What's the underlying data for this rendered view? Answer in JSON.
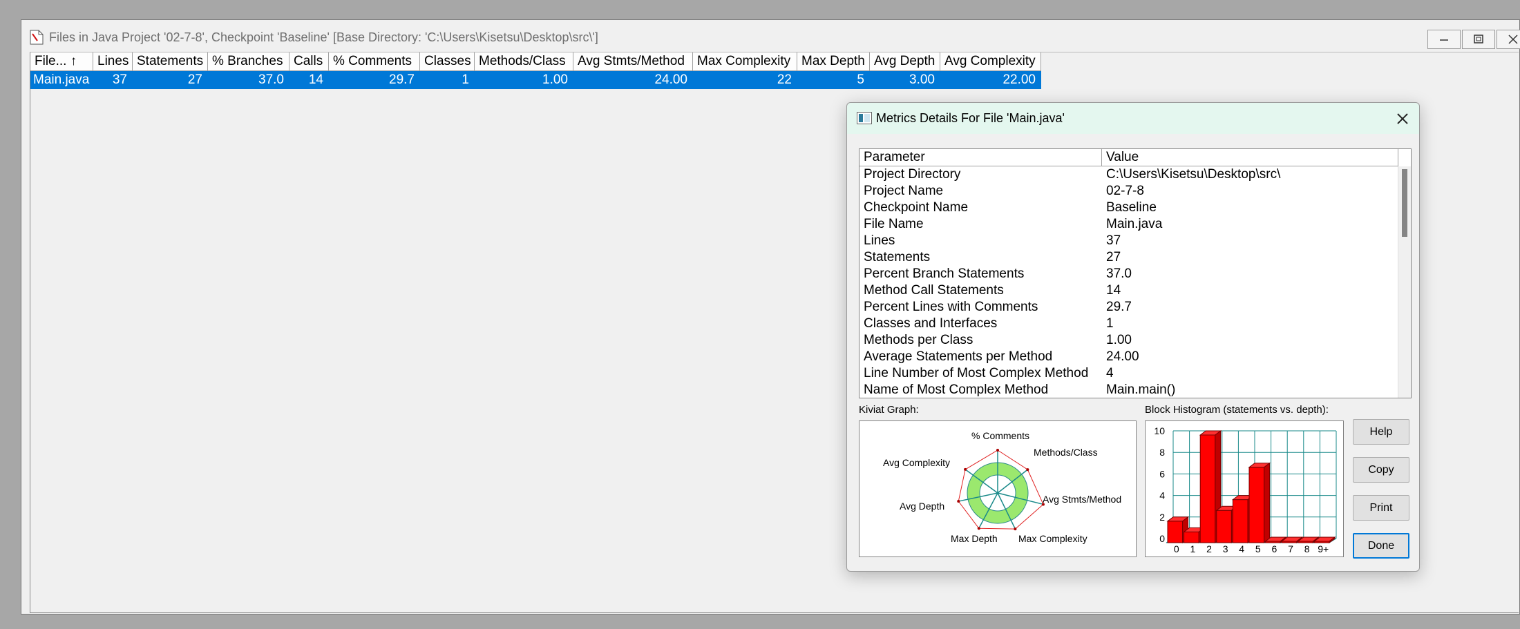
{
  "window": {
    "title": "Files in Java Project '02-7-8', Checkpoint 'Baseline'  [Base Directory: 'C:\\Users\\Kisetsu\\Desktop\\src\\']"
  },
  "grid": {
    "columns": [
      "File... ↑",
      "Lines",
      "Statements",
      "% Branches",
      "Calls",
      "% Comments",
      "Classes",
      "Methods/Class",
      "Avg Stmts/Method",
      "Max Complexity",
      "Max Depth",
      "Avg Depth",
      "Avg Complexity"
    ],
    "rows": [
      [
        "Main.java",
        "37",
        "27",
        "37.0",
        "14",
        "29.7",
        "1",
        "1.00",
        "24.00",
        "22",
        "5",
        "3.00",
        "22.00"
      ]
    ]
  },
  "dialog": {
    "title": "Metrics Details For File 'Main.java'",
    "table_headers": [
      "Parameter",
      "Value"
    ],
    "rows": [
      [
        "Project Directory",
        "C:\\Users\\Kisetsu\\Desktop\\src\\"
      ],
      [
        "Project Name",
        "02-7-8"
      ],
      [
        "Checkpoint Name",
        "Baseline"
      ],
      [
        "File Name",
        "Main.java"
      ],
      [
        "Lines",
        "37"
      ],
      [
        "Statements",
        "27"
      ],
      [
        "Percent Branch Statements",
        "37.0"
      ],
      [
        "Method Call Statements",
        "14"
      ],
      [
        "Percent Lines with Comments",
        "29.7"
      ],
      [
        "Classes and Interfaces",
        "1"
      ],
      [
        "Methods per Class",
        "1.00"
      ],
      [
        "Average Statements per Method",
        "24.00"
      ],
      [
        "Line Number of Most Complex Method",
        "4"
      ],
      [
        "Name of Most Complex Method",
        "Main.main()"
      ]
    ],
    "kiviat_label": "Kiviat Graph:",
    "kiviat_axes": [
      "% Comments",
      "Methods/Class",
      "Avg Stmts/Method",
      "Max Complexity",
      "Max Depth",
      "Avg Depth",
      "Avg Complexity"
    ],
    "histogram_label": "Block Histogram (statements vs. depth):",
    "histogram": {
      "categories": [
        "0",
        "1",
        "2",
        "3",
        "4",
        "5",
        "6",
        "7",
        "8",
        "9+"
      ],
      "values": [
        2,
        1,
        10,
        3,
        4,
        7,
        0,
        0,
        0,
        0
      ],
      "y_ticks": [
        "0",
        "2",
        "4",
        "6",
        "8",
        "10"
      ]
    },
    "buttons": {
      "help": "Help",
      "copy": "Copy",
      "print": "Print",
      "done": "Done"
    }
  },
  "colors": {
    "selection": "#0078d7",
    "bar": "#ff0000",
    "kiviat_fill": "#9be86e",
    "grid_line": "#1a8a8a"
  }
}
